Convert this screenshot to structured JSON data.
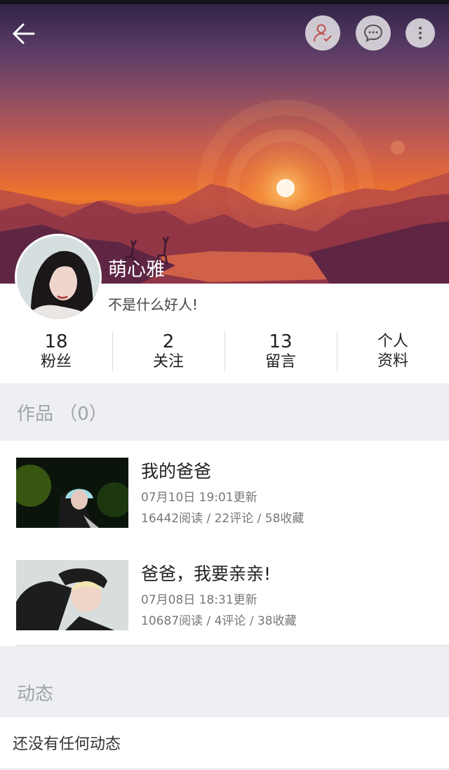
{
  "profile": {
    "username": "萌心雅",
    "bio": "不是什么好人!"
  },
  "stats": [
    {
      "value": "18",
      "label": "粉丝"
    },
    {
      "value": "2",
      "label": "关注"
    },
    {
      "value": "13",
      "label": "留言"
    },
    {
      "label_line1": "个人",
      "label_line2": "资料"
    }
  ],
  "works": {
    "header": "作品 （0）",
    "items": [
      {
        "title": "我的爸爸",
        "updated": "07月10日 19:01更新",
        "stats": "16442阅读 / 22评论 / 58收藏"
      },
      {
        "title": "爸爸，我要亲亲!",
        "updated": "07月08日 18:31更新",
        "stats": "10687阅读 / 4评论 / 38收藏"
      }
    ]
  },
  "feed": {
    "header": "动态",
    "empty_text": "还没有任何动态"
  },
  "icons": {
    "back": "arrow-left-icon",
    "follow": "user-check-icon",
    "message": "chat-bubble-icon",
    "more": "more-vertical-icon"
  },
  "colors": {
    "banner_top": "#2e2244",
    "banner_sun": "#f07a2b",
    "section_bg": "#eeeff3",
    "muted_text": "#a0a3ab"
  }
}
